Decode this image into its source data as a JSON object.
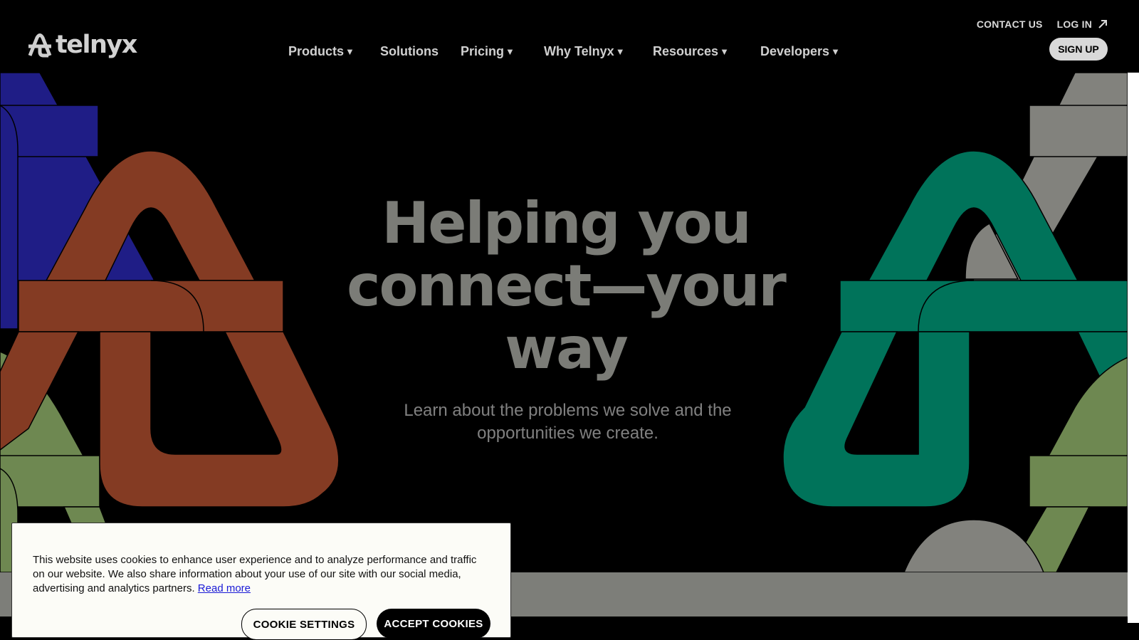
{
  "header": {
    "logo_text": "telnyx",
    "contact_label": "CONTACT US",
    "login_label": "LOG IN",
    "signup_label": "SIGN UP",
    "nav": [
      {
        "label": "Products",
        "dropdown": true
      },
      {
        "label": "Solutions",
        "dropdown": false
      },
      {
        "label": "Pricing",
        "dropdown": true
      },
      {
        "label": "Why Telnyx",
        "dropdown": true
      },
      {
        "label": "Resources",
        "dropdown": true
      },
      {
        "label": "Developers",
        "dropdown": true
      }
    ]
  },
  "hero": {
    "heading_line1": "Helping you",
    "heading_line2": "connect—your",
    "heading_line3": "way",
    "subheading": "Learn about the problems we solve and the opportunities we create."
  },
  "cookie": {
    "message": "This website uses cookies to enhance user experience and to analyze performance and traffic on our website. We also share information about your use of our site with our social media, advertising and analytics partners.",
    "read_more": "Read more",
    "settings_label": "COOKIE SETTINGS",
    "accept_label": "ACCEPT COOKIES"
  },
  "colors": {
    "background": "#000000",
    "heading": "#7b7c77",
    "blue": "#1f1d86",
    "rust": "#843b23",
    "sage": "#6e8851",
    "green": "#00735a",
    "gray": "#82827d"
  },
  "icons": [
    "telnyx-logo-icon",
    "external-arrow-icon",
    "caret-down-icon"
  ]
}
